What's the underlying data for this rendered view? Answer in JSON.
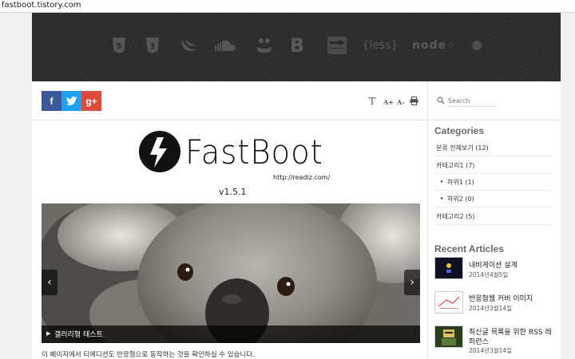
{
  "browser": {
    "url": "fastboot.tistory.com"
  },
  "hero": {
    "tech_icons": [
      "html5-icon",
      "css3-icon",
      "jquery-icon",
      "soundcloud-icon",
      "handlebars-icon",
      "bootstrap-icon",
      "grunt-icon",
      "less-icon",
      "node-icon",
      "npm-icon"
    ],
    "less_label": "{less}",
    "node_label": "node",
    "bootstrap_label": "B",
    "html5_label": "5",
    "css3_label": "3"
  },
  "share": {
    "facebook": "f",
    "twitter": "t",
    "googleplus": "g+"
  },
  "tools": {
    "font": "T",
    "bigger": "A+",
    "smaller": "A-",
    "print": "print"
  },
  "logo": {
    "name": "FastBoot",
    "url": "http://readiz.com/",
    "version": "v1.5.1"
  },
  "gallery": {
    "caption": "갤러리형 테스트",
    "prev": "‹",
    "next": "›"
  },
  "content": {
    "text": "이 페이지에서 티에디션도 반응형으로 동작하는 것을 확인하실 수 있습니다."
  },
  "sidebar": {
    "search_placeholder": "Search",
    "categories_title": "Categories",
    "categories": [
      {
        "label": "분류 전체보기 (12)",
        "level": 0
      },
      {
        "label": "카테고리1 (7)",
        "level": 0
      },
      {
        "label": "하위1 (1)",
        "level": 1
      },
      {
        "label": "하위2 (0)",
        "level": 1
      },
      {
        "label": "카테고리2 (5)",
        "level": 0
      }
    ],
    "recent_title": "Recent Articles",
    "articles": [
      {
        "title": "내비게이션 설계",
        "date": "2014년4월5일"
      },
      {
        "title": "반응형웹 커버 이미지",
        "date": "2014년3월14일"
      },
      {
        "title": "최신글 목록을 위한 RSS 레",
        "title2": "퍼런스",
        "date": "2014년3월14일"
      }
    ]
  },
  "colors": {
    "facebook": "#3b5998",
    "twitter": "#1da1f2",
    "googleplus": "#dd4b39",
    "hero_bg": "#2a2a2a",
    "sidebar_title": "#6a6a6a"
  }
}
